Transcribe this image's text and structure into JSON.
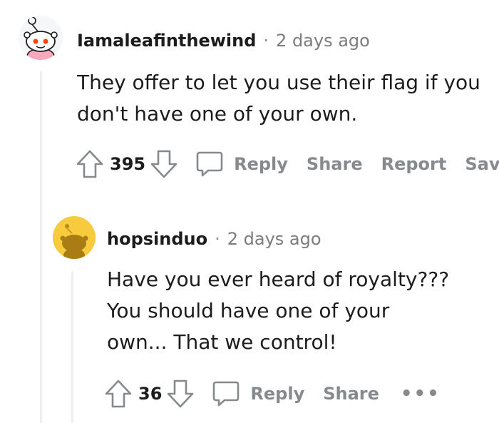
{
  "comments": [
    {
      "username": "Iamaleafinthewind",
      "separator": "·",
      "time": "2 days ago",
      "body_lines": [
        "They offer to let you use their flag if you",
        "don't have one of your own."
      ],
      "score": "395",
      "actions": {
        "reply": "Reply",
        "share": "Share",
        "report": "Report",
        "save": "Save"
      },
      "avatar_icon": "snoo-avatar-pink-shirt"
    },
    {
      "username": "hopsinduo",
      "separator": "·",
      "time": "2 days ago",
      "body_lines": [
        "Have you ever heard of royalty???",
        "You should have one of your",
        "own... That we control!"
      ],
      "score": "36",
      "actions": {
        "reply": "Reply",
        "share": "Share",
        "more": "•••"
      },
      "avatar_icon": "snoo-avatar-yellow"
    }
  ],
  "colors": {
    "meta_gray": "#7c7c7c",
    "action_gray": "#878a8c",
    "thread_line": "#edeff1",
    "avatar_yellow": "#f7cb3d"
  }
}
